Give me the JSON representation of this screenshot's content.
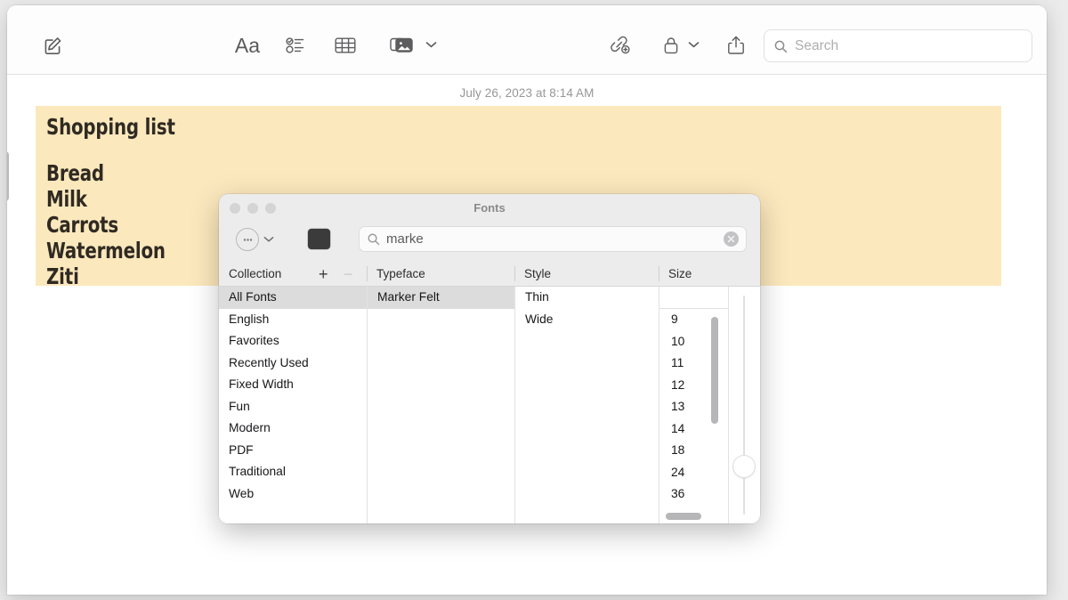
{
  "window": {
    "toolbar": {
      "compose_icon": "compose-icon",
      "format_label": "Aa",
      "checklist_icon": "checklist-icon",
      "table_icon": "table-icon",
      "media_icon": "media-icon",
      "media_chevron_icon": "chevron-down-icon",
      "link_icon": "add-link-icon",
      "lock_icon": "lock-icon",
      "lock_chevron_icon": "chevron-down-icon",
      "share_icon": "share-icon",
      "search_icon": "search-icon",
      "search_placeholder": "Search",
      "search_value": ""
    }
  },
  "note": {
    "date": "July 26, 2023 at 8:14 AM",
    "title": "Shopping list",
    "items": [
      "Bread",
      "Milk",
      "Carrots",
      "Watermelon",
      "Ziti"
    ],
    "highlight_color": "#fce8bd",
    "text_color": "#2f2a22"
  },
  "fonts_panel": {
    "title": "Fonts",
    "traffic_lights": [
      "close-button",
      "minimize-button",
      "zoom-button"
    ],
    "action_menu_icon": "ellipsis-circle-icon",
    "action_menu_chevron_icon": "chevron-down-icon",
    "color_swatch": "#3b3b3b",
    "search": {
      "icon": "search-icon",
      "value": "marke",
      "clear_icon": "clear-icon"
    },
    "headers": {
      "collection": "Collection",
      "add_label": "+",
      "remove_label": "−",
      "typeface": "Typeface",
      "style": "Style",
      "size": "Size"
    },
    "collections": [
      {
        "label": "All Fonts",
        "selected": true
      },
      {
        "label": "English",
        "selected": false
      },
      {
        "label": "Favorites",
        "selected": false
      },
      {
        "label": "Recently Used",
        "selected": false
      },
      {
        "label": "Fixed Width",
        "selected": false
      },
      {
        "label": "Fun",
        "selected": false
      },
      {
        "label": "Modern",
        "selected": false
      },
      {
        "label": "PDF",
        "selected": false
      },
      {
        "label": "Traditional",
        "selected": false
      },
      {
        "label": "Web",
        "selected": false
      }
    ],
    "typefaces": [
      {
        "label": "Marker Felt",
        "selected": true
      }
    ],
    "styles": [
      {
        "label": "Thin",
        "selected": false
      },
      {
        "label": "Wide",
        "selected": false
      }
    ],
    "size_value": "",
    "sizes": [
      "9",
      "10",
      "11",
      "12",
      "13",
      "14",
      "18",
      "24",
      "36"
    ]
  }
}
